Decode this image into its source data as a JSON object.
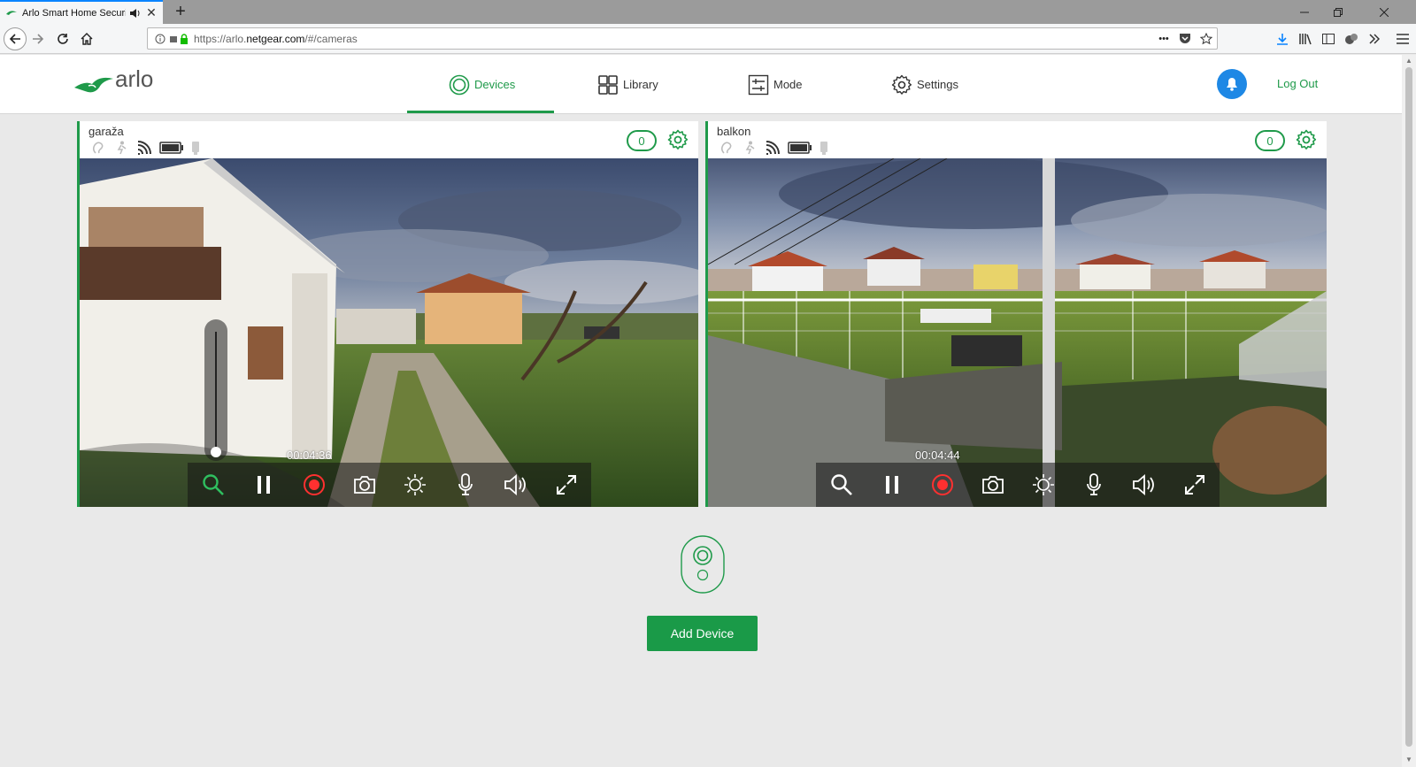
{
  "browser": {
    "tab_title": "Arlo Smart Home Security C",
    "url_prefix": "https://arlo.",
    "url_host": "netgear.com",
    "url_path": "/#/cameras",
    "url_dots": "•••"
  },
  "app": {
    "logo_text": "arlo",
    "nav": [
      {
        "label": "Devices",
        "icon": "devices-icon",
        "active": true
      },
      {
        "label": "Library",
        "icon": "library-icon"
      },
      {
        "label": "Mode",
        "icon": "mode-icon"
      },
      {
        "label": "Settings",
        "icon": "settings-icon"
      }
    ],
    "logout_label": "Log Out",
    "accent_color": "#1f9a4a"
  },
  "cameras": [
    {
      "name": "garaža",
      "badge": "0",
      "timer": "00:04:36"
    },
    {
      "name": "balkon",
      "badge": "0",
      "timer": "00:04:44"
    }
  ],
  "add_device_label": "Add Device"
}
